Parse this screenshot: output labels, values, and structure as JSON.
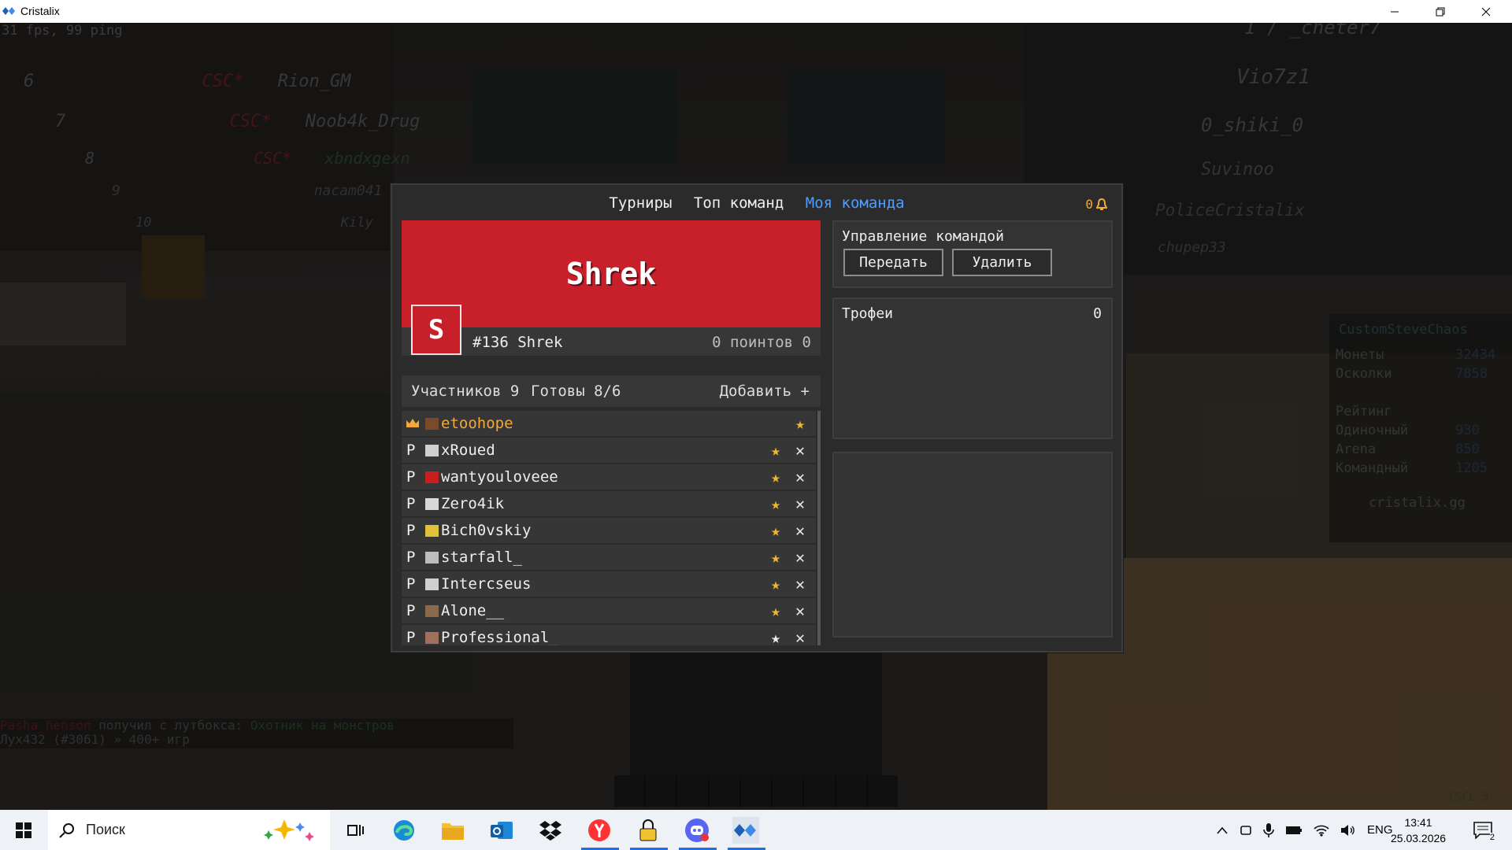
{
  "window": {
    "title": "Cristalix"
  },
  "hud": {
    "fps": "31 fps, 99 ping",
    "chat_line1_name": "Pasha_henson",
    "chat_line1_mid": " получил с лутбокса: ",
    "chat_line1_item": "Охотник на монстров",
    "chat_line2": "Лух432 (#3061) » 400+ игр",
    "corner_tag": "CSCL-3"
  },
  "scoreboard_left": [
    {
      "num": "6",
      "tag": "CSC*",
      "name": "Rion_GM"
    },
    {
      "num": "7",
      "tag": "CSC*",
      "name": "Noob4k_Drug"
    },
    {
      "num": "8",
      "tag": "CSC*",
      "name": "xbndxgexn"
    },
    {
      "num": "9",
      "tag": "",
      "name": "nacam041"
    },
    {
      "num": "10",
      "tag": "",
      "name": "Kily"
    }
  ],
  "scoreboard_right": [
    "1 / _cheter7",
    "Vio7z1",
    "0_shiki_0",
    "Suvinoo",
    "PoliceCristalix",
    "chupep33"
  ],
  "sidebar": {
    "name": "CustomSteveChaos",
    "coins_label": "Монеты",
    "coins_value": "32434",
    "shards_label": "Осколки",
    "shards_value": "7858",
    "rating_label": "Рейтинг",
    "solo_label": "Одиночный",
    "solo_value": "930",
    "arena_label": "Arena",
    "arena_value": "850",
    "team_label": "Командный",
    "team_value": "1205",
    "site": "cristalix.gg"
  },
  "dialog": {
    "tabs": [
      "Турниры",
      "Топ команд",
      "Моя команда"
    ],
    "active_tab": 2,
    "notifications": "0"
  },
  "team": {
    "name": "Shrek",
    "badge_letter": "S",
    "rank": "#136 Shrek",
    "points": "0 поинтов 0",
    "color": "#c8202b"
  },
  "members": {
    "count_label": "Участников 9",
    "ready_label": "Готовы 8/6",
    "add_label": "Добавить +",
    "list": [
      {
        "role": "",
        "nick": "etoohope",
        "owner": true,
        "star": "★"
      },
      {
        "role": "P",
        "nick": "xRoued",
        "owner": false,
        "star": "★"
      },
      {
        "role": "P",
        "nick": "wantyouloveee",
        "owner": false,
        "star": "★"
      },
      {
        "role": "P",
        "nick": "Zero4ik",
        "owner": false,
        "star": "★"
      },
      {
        "role": "P",
        "nick": "Bich0vskiy",
        "owner": false,
        "star": "★"
      },
      {
        "role": "P",
        "nick": "starfall_",
        "owner": false,
        "star": "★"
      },
      {
        "role": "P",
        "nick": "Intercseus",
        "owner": false,
        "star": "★"
      },
      {
        "role": "P",
        "nick": "Alone__",
        "owner": false,
        "star": "★"
      },
      {
        "role": "P",
        "nick": "Professional_",
        "owner": false,
        "star": "★"
      }
    ]
  },
  "management": {
    "title": "Управление командой",
    "transfer_label": "Передать",
    "delete_label": "Удалить"
  },
  "trophies": {
    "title": "Трофеи",
    "count": "0"
  },
  "taskbar": {
    "search_placeholder": "Поиск",
    "lang": "ENG",
    "time": "13:41",
    "date": "25.03.2026",
    "notif_count": "2"
  },
  "colors": {
    "accent": "#4f9dff",
    "gold": "#f2a93b",
    "team_red": "#c8202b"
  }
}
